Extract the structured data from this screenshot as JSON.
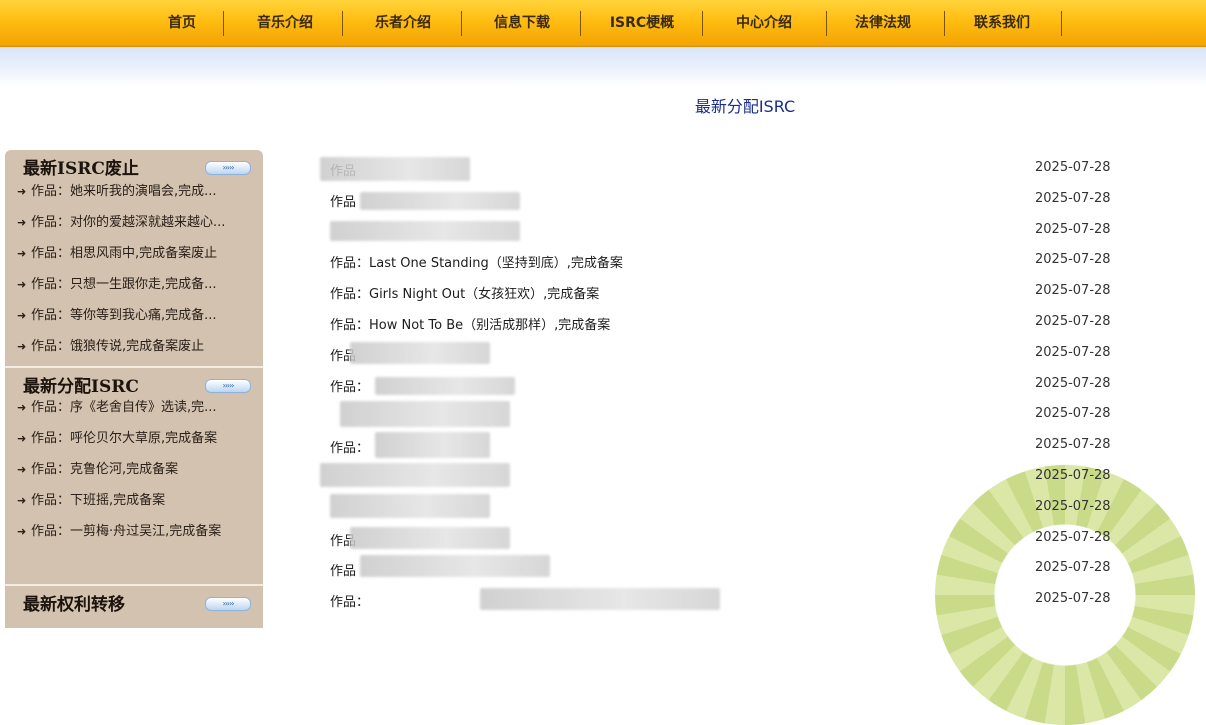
{
  "nav": {
    "items": [
      "首页",
      "音乐介绍",
      "乐者介绍",
      "信息下载",
      "ISRC梗概",
      "中心介绍",
      "法律法规",
      "联系我们"
    ]
  },
  "page_title": "最新分配ISRC",
  "sidebar": {
    "more_label": "›››››",
    "blocks": [
      {
        "heading": "最新ISRC废止",
        "items": [
          "作品：她来听我的演唱会,完成...",
          "作品：对你的爱越深就越来越心...",
          "作品：相思风雨中,完成备案废止",
          "作品：只想一生跟你走,完成备...",
          "作品：等你等到我心痛,完成备...",
          "作品：饿狼传说,完成备案废止"
        ]
      },
      {
        "heading": "最新分配ISRC",
        "items": [
          "作品：序《老舍自传》选读,完...",
          "作品：呼伦贝尔大草原,完成备案",
          "作品：克鲁伦河,完成备案",
          "作品：下班摇,完成备案",
          "作品：一剪梅·舟过吴江,完成备案"
        ]
      },
      {
        "heading": "最新权利转移",
        "items": []
      }
    ]
  },
  "list": {
    "rows": [
      {
        "title": "作品",
        "date": "2025-07-28"
      },
      {
        "title": "作品",
        "date": "2025-07-28"
      },
      {
        "title": "",
        "date": "2025-07-28"
      },
      {
        "title": "作品：Last One Standing（坚持到底）,完成备案",
        "date": "2025-07-28"
      },
      {
        "title": "作品：Girls Night Out（女孩狂欢）,完成备案",
        "date": "2025-07-28"
      },
      {
        "title": "作品：How Not To Be（别活成那样）,完成备案",
        "date": "2025-07-28"
      },
      {
        "title": "作品",
        "date": "2025-07-28"
      },
      {
        "title": "作品：",
        "date": "2025-07-28"
      },
      {
        "title": "",
        "date": "2025-07-28"
      },
      {
        "title": "作品：",
        "date": "2025-07-28"
      },
      {
        "title": "",
        "date": "2025-07-28"
      },
      {
        "title": "",
        "date": "2025-07-28"
      },
      {
        "title": "作品",
        "date": "2025-07-28"
      },
      {
        "title": "作品",
        "date": "2025-07-28"
      },
      {
        "title": "作品：",
        "date": "2025-07-28"
      }
    ]
  }
}
